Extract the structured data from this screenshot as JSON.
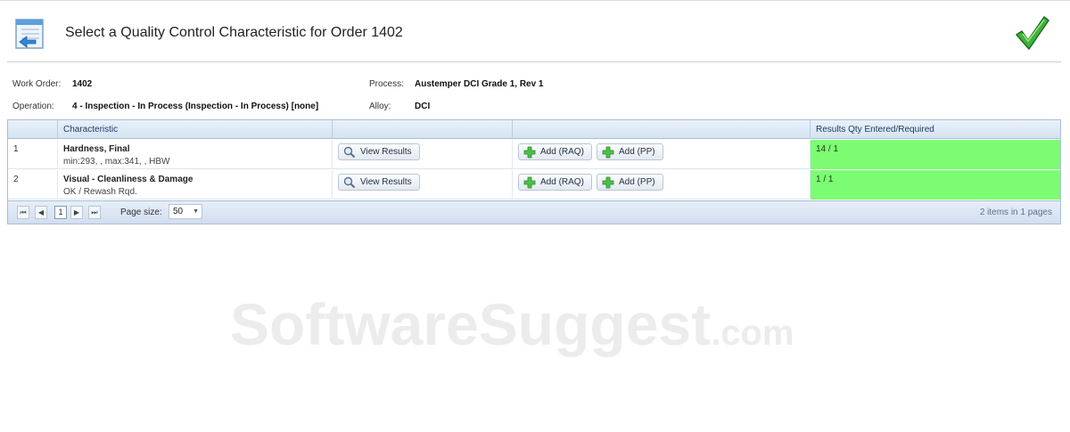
{
  "header": {
    "title": "Select a Quality Control Characteristic for Order 1402",
    "icon": "form-arrow-icon",
    "confirm_icon": "green-checkmark-icon"
  },
  "order_info": {
    "work_order_label": "Work Order:",
    "work_order_value": "1402",
    "process_label": "Process:",
    "process_value": "Austemper DCI Grade 1, Rev 1",
    "operation_label": "Operation:",
    "operation_value": "4 - Inspection - In Process (Inspection - In Process) [none]",
    "alloy_label": "Alloy:",
    "alloy_value": "DCI"
  },
  "grid": {
    "columns": [
      "",
      "Characteristic",
      "",
      "",
      "Results Qty Entered/Required"
    ],
    "rows": [
      {
        "num": "1",
        "name": "Hardness, Final",
        "spec": "min:293, , max:341, , HBW",
        "view_label": "View Results",
        "add_raq_label": "Add (RAQ)",
        "add_pp_label": "Add (PP)",
        "qty": "14 / 1"
      },
      {
        "num": "2",
        "name": "Visual - Cleanliness & Damage",
        "spec": "OK / Rewash Rqd.",
        "view_label": "View Results",
        "add_raq_label": "Add (RAQ)",
        "add_pp_label": "Add (PP)",
        "qty": "1 / 1"
      }
    ],
    "pager": {
      "first": "⏮",
      "prev": "◀",
      "page": "1",
      "next": "▶",
      "last": "⏭",
      "page_size_label": "Page size:",
      "page_size_value": "50",
      "summary": "2 items in 1 pages"
    }
  },
  "colors": {
    "qty_ok": "#7cfc73",
    "accent": "#1f3b66"
  },
  "watermark": {
    "main": "SoftwareSuggest",
    "suffix": ".com"
  }
}
